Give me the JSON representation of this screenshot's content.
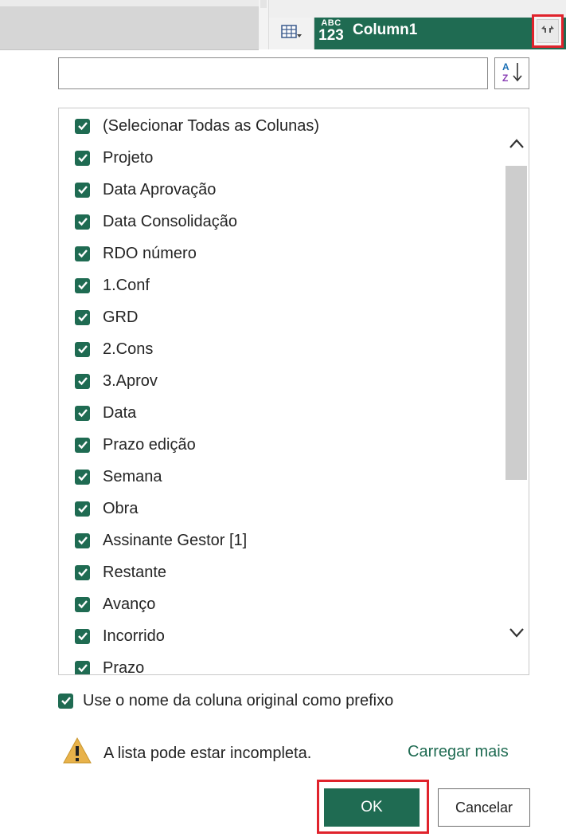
{
  "header": {
    "type_badge_top": "ABC",
    "type_badge_bottom": "123",
    "column_name": "Column1"
  },
  "search": {
    "value": "",
    "placeholder": ""
  },
  "list": {
    "items": [
      {
        "label": "(Selecionar Todas as Colunas)",
        "checked": true
      },
      {
        "label": "Projeto",
        "checked": true
      },
      {
        "label": "Data Aprovação",
        "checked": true
      },
      {
        "label": "Data Consolidação",
        "checked": true
      },
      {
        "label": "RDO número",
        "checked": true
      },
      {
        "label": "1.Conf",
        "checked": true
      },
      {
        "label": "GRD",
        "checked": true
      },
      {
        "label": "2.Cons",
        "checked": true
      },
      {
        "label": "3.Aprov",
        "checked": true
      },
      {
        "label": "Data",
        "checked": true
      },
      {
        "label": "Prazo edição",
        "checked": true
      },
      {
        "label": "Semana",
        "checked": true
      },
      {
        "label": "Obra",
        "checked": true
      },
      {
        "label": "Assinante Gestor [1]",
        "checked": true
      },
      {
        "label": "Restante",
        "checked": true
      },
      {
        "label": "Avanço",
        "checked": true
      },
      {
        "label": "Incorrido",
        "checked": true
      },
      {
        "label": "Prazo",
        "checked": true
      }
    ]
  },
  "prefix_option": {
    "label": "Use o nome da coluna original como prefixo",
    "checked": true
  },
  "warning": {
    "text": "A lista pode estar incompleta.",
    "load_more": "Carregar mais"
  },
  "buttons": {
    "ok": "OK",
    "cancel": "Cancelar"
  },
  "colors": {
    "accent": "#1f6b52",
    "highlight": "#e0232c",
    "warning": "#e8b24a"
  },
  "icons": [
    "table-dropdown-icon",
    "expand-column-icon",
    "sort-az-icon",
    "chevron-up-icon",
    "chevron-down-icon",
    "checkmark-icon",
    "warning-icon"
  ]
}
